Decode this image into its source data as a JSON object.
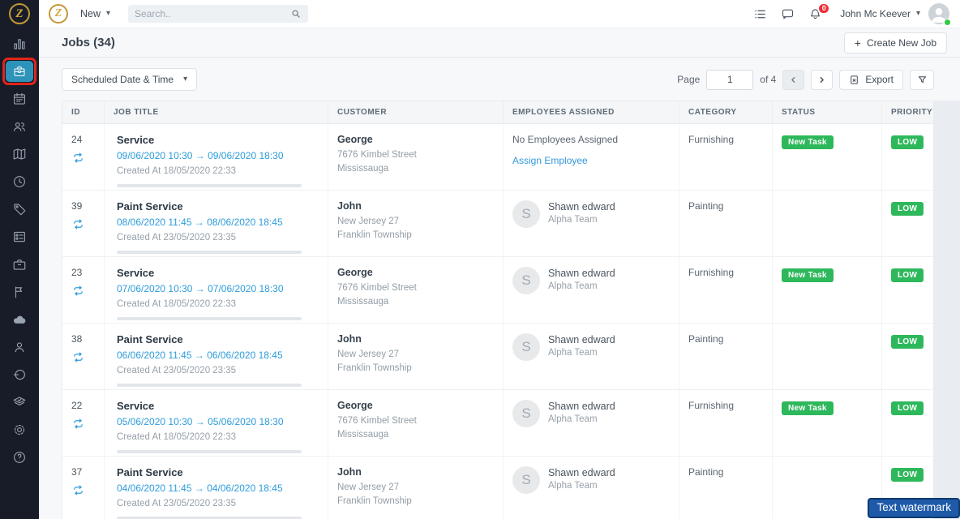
{
  "brand": {
    "letter": "Z"
  },
  "colors": {
    "accent_blue": "#2d9cdb",
    "sidebar_active": "#2e93b8",
    "badge_green": "#2eb85c",
    "annotation_red": "#e1251b",
    "watermark_blue": "#1e5aa8",
    "brand_gold": "#c39738",
    "notification_red": "#ef2d38"
  },
  "topbar": {
    "new_label": "New",
    "search_placeholder": "Search..",
    "notification_badge": "0",
    "user_name": "John Mc Keever"
  },
  "sidebar": {
    "items": [
      {
        "icon": "dashboard",
        "active": false
      },
      {
        "icon": "jobs",
        "active": true
      },
      {
        "icon": "scheduling",
        "active": false
      },
      {
        "icon": "teams",
        "active": false
      },
      {
        "icon": "map",
        "active": false
      },
      {
        "icon": "timesheets",
        "active": false
      },
      {
        "icon": "tags",
        "active": false
      },
      {
        "icon": "quotes",
        "active": false
      },
      {
        "icon": "assets",
        "active": false
      },
      {
        "icon": "reports",
        "active": false
      },
      {
        "icon": "cloud",
        "active": false
      },
      {
        "icon": "customers",
        "active": false
      },
      {
        "icon": "timer",
        "active": false
      },
      {
        "icon": "approvals",
        "active": false
      },
      {
        "icon": "settings",
        "active": false
      },
      {
        "icon": "help",
        "active": false
      }
    ]
  },
  "page": {
    "title": "Jobs (34)",
    "create_button": "Create New Job"
  },
  "toolbar": {
    "sort_dropdown": "Scheduled Date & Time",
    "page_label": "Page",
    "page_value": "1",
    "page_total": "of 4",
    "export_label": "Export"
  },
  "table": {
    "columns": [
      "ID",
      "JOB TITLE",
      "CUSTOMER",
      "EMPLOYEES ASSIGNED",
      "CATEGORY",
      "STATUS",
      "PRIORITY"
    ],
    "rows": [
      {
        "id": "24",
        "title": "Service",
        "schedule": "09/06/2020 10:30 → 09/06/2020 18:30",
        "created": "Created At 18/05/2020 22:33",
        "customer_name": "George",
        "customer_addr1": "7676 Kimbel Street",
        "customer_addr2": "Mississauga",
        "employee": null,
        "no_employees": "No Employees Assigned",
        "assign_link": "Assign Employee",
        "category": "Furnishing",
        "status": "New Task",
        "priority": "LOW"
      },
      {
        "id": "39",
        "title": "Paint Service",
        "schedule": "08/06/2020 11:45 → 08/06/2020 18:45",
        "created": "Created At 23/05/2020 23:35",
        "customer_name": "John",
        "customer_addr1": "New Jersey 27",
        "customer_addr2": "Franklin Township",
        "employee": {
          "avatar_letter": "S",
          "name": "Shawn edward",
          "team": "Alpha Team"
        },
        "category": "Painting",
        "status": "",
        "priority": "LOW"
      },
      {
        "id": "23",
        "title": "Service",
        "schedule": "07/06/2020 10:30 → 07/06/2020 18:30",
        "created": "Created At 18/05/2020 22:33",
        "customer_name": "George",
        "customer_addr1": "7676 Kimbel Street",
        "customer_addr2": "Mississauga",
        "employee": {
          "avatar_letter": "S",
          "name": "Shawn edward",
          "team": "Alpha Team"
        },
        "category": "Furnishing",
        "status": "New Task",
        "priority": "LOW"
      },
      {
        "id": "38",
        "title": "Paint Service",
        "schedule": "06/06/2020 11:45 → 06/06/2020 18:45",
        "created": "Created At 23/05/2020 23:35",
        "customer_name": "John",
        "customer_addr1": "New Jersey 27",
        "customer_addr2": "Franklin Township",
        "employee": {
          "avatar_letter": "S",
          "name": "Shawn edward",
          "team": "Alpha Team"
        },
        "category": "Painting",
        "status": "",
        "priority": "LOW"
      },
      {
        "id": "22",
        "title": "Service",
        "schedule": "05/06/2020 10:30 → 05/06/2020 18:30",
        "created": "Created At 18/05/2020 22:33",
        "customer_name": "George",
        "customer_addr1": "7676 Kimbel Street",
        "customer_addr2": "Mississauga",
        "employee": {
          "avatar_letter": "S",
          "name": "Shawn edward",
          "team": "Alpha Team"
        },
        "category": "Furnishing",
        "status": "New Task",
        "priority": "LOW"
      },
      {
        "id": "37",
        "title": "Paint Service",
        "schedule": "04/06/2020 11:45 → 04/06/2020 18:45",
        "created": "Created At 23/05/2020 23:35",
        "customer_name": "John",
        "customer_addr1": "New Jersey 27",
        "customer_addr2": "Franklin Township",
        "employee": {
          "avatar_letter": "S",
          "name": "Shawn edward",
          "team": "Alpha Team"
        },
        "category": "Painting",
        "status": "",
        "priority": "LOW"
      }
    ]
  },
  "watermark": "Text watermark"
}
